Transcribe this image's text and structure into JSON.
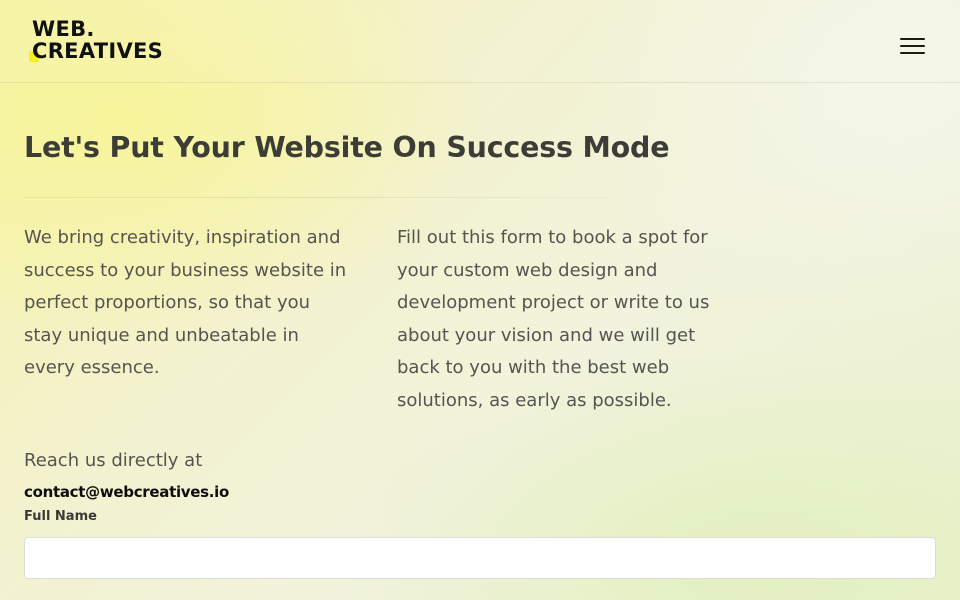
{
  "header": {
    "logo_line1": "WEB.",
    "logo_line2": "CREATIVES",
    "accent_color": "#f6ee22",
    "menu_icon": "hamburger-menu-icon"
  },
  "main": {
    "title": "Let's Put Your Website On Success Mode",
    "intro_left_lines": [
      "We bring creativity, inspiration and",
      "success to your business website in",
      "perfect proportions, so that you",
      "stay unique and unbeatable in",
      "every essence."
    ],
    "intro_right_lines": [
      "Fill out this form to book a spot for",
      "your custom web design and",
      "development project or write to us",
      "about your vision and we will get",
      "back to you with the best web",
      "solutions, as early as possible."
    ],
    "reach_label": "Reach us directly at",
    "email": "contact@webcreatives.io"
  },
  "form": {
    "full_name_label": "Full Name",
    "full_name_value": "",
    "full_name_placeholder": ""
  }
}
